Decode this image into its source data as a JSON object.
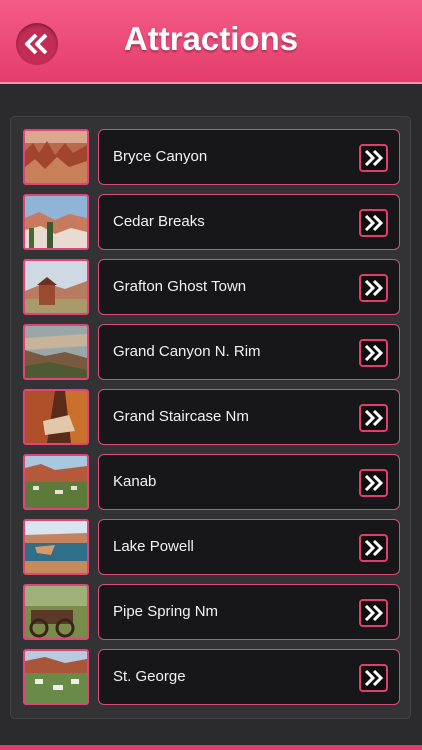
{
  "header": {
    "title": "Attractions",
    "back_icon": "double-chevron-left-icon"
  },
  "attractions": [
    {
      "label": "Bryce Canyon",
      "icon": "double-chevron-right-icon"
    },
    {
      "label": "Cedar Breaks",
      "icon": "double-chevron-right-icon"
    },
    {
      "label": "Grafton Ghost Town",
      "icon": "double-chevron-right-icon"
    },
    {
      "label": "Grand Canyon N. Rim",
      "icon": "double-chevron-right-icon"
    },
    {
      "label": "Grand Staircase Nm",
      "icon": "double-chevron-right-icon"
    },
    {
      "label": "Kanab",
      "icon": "double-chevron-right-icon"
    },
    {
      "label": "Lake Powell",
      "icon": "double-chevron-right-icon"
    },
    {
      "label": "Pipe Spring Nm",
      "icon": "double-chevron-right-icon"
    },
    {
      "label": "St. George",
      "icon": "double-chevron-right-icon"
    }
  ],
  "colors": {
    "accent": "#e43d6d",
    "header_bg": "#f04f7d",
    "item_bg": "#171719",
    "page_bg": "#2b2b2d"
  }
}
